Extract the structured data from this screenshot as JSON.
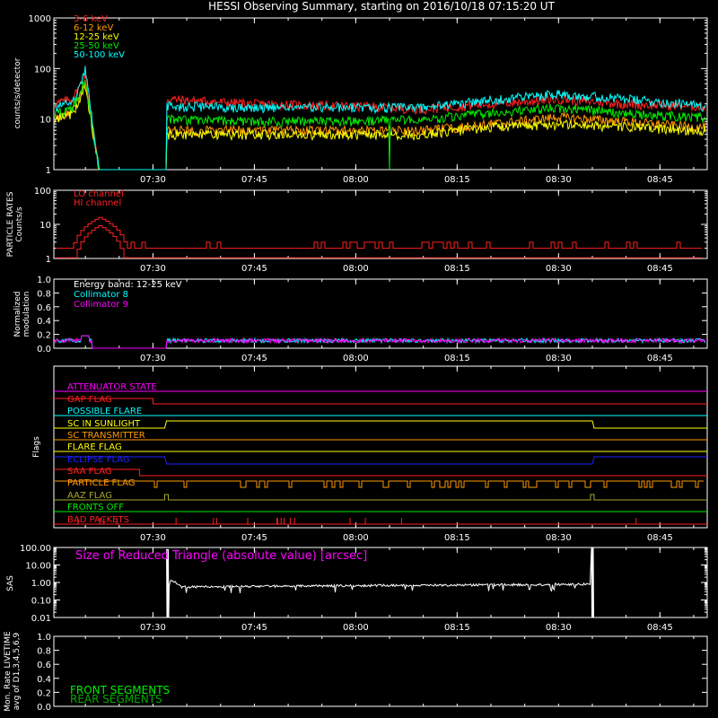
{
  "title": "HESSI Observing Summary, starting on 2016/10/18 07:15:20 UT",
  "time_ticks": [
    "07:30",
    "07:45",
    "08:00",
    "08:15",
    "08:30",
    "08:45"
  ],
  "colors": {
    "red": "#ff2020",
    "orange": "#ff9a00",
    "yellow": "#ffff00",
    "green": "#00ee00",
    "cyan": "#00ffff",
    "magenta": "#ff00ff",
    "blue": "#2020ff",
    "olive": "#a8a830",
    "white": "#ffffff",
    "darkgreen": "#00aa00"
  },
  "chart_data": [
    {
      "id": "count_rates",
      "type": "line",
      "ylabel": "counts/s/detector",
      "yscale": "log",
      "ylim": [
        1,
        1000
      ],
      "ytick_labels": [
        "1",
        "10",
        "100",
        "1000"
      ],
      "x": [
        "07:15:20",
        "07:18",
        "07:19",
        "07:20",
        "07:22",
        "07:22",
        "07:32",
        "07:32",
        "07:45",
        "08:00",
        "08:10",
        "08:20",
        "08:30",
        "08:40",
        "08:50",
        "08:52"
      ],
      "series": [
        {
          "name": "3-6 keV",
          "color": "red",
          "values": [
            20,
            25,
            40,
            80,
            1,
            1,
            1,
            25,
            20,
            18,
            16,
            20,
            25,
            20,
            18,
            18
          ]
        },
        {
          "name": "6-12 keV",
          "color": "orange",
          "values": [
            10,
            14,
            25,
            50,
            1,
            1,
            1,
            6,
            6,
            6,
            6,
            8,
            11,
            9,
            7,
            7
          ]
        },
        {
          "name": "12-25 keV",
          "color": "yellow",
          "values": [
            10,
            13,
            22,
            45,
            1,
            1,
            1,
            5,
            5,
            5,
            5,
            7,
            8,
            7,
            6,
            6
          ]
        },
        {
          "name": "25-50 keV",
          "color": "green",
          "values": [
            13,
            16,
            30,
            60,
            1,
            1,
            1,
            10,
            9,
            9,
            10,
            13,
            17,
            13,
            11,
            11
          ]
        },
        {
          "name": "50-100 keV",
          "color": "cyan",
          "values": [
            17,
            22,
            40,
            95,
            1,
            1,
            1,
            18,
            17,
            17,
            17,
            24,
            32,
            25,
            19,
            18
          ]
        }
      ]
    },
    {
      "id": "particle_rates",
      "type": "line",
      "ylabel": "PARTICLE RATES Counts/s",
      "yscale": "log",
      "ylim": [
        1,
        100
      ],
      "ytick_labels": [
        "1",
        "10",
        "100"
      ],
      "x": [
        "07:16",
        "07:18",
        "07:20",
        "07:22",
        "07:24",
        "07:26",
        "07:28",
        "07:45",
        "08:00",
        "08:15",
        "08:30",
        "08:45",
        "08:52"
      ],
      "series": [
        {
          "name": "LO channel",
          "color": "red",
          "values": [
            2,
            2,
            8,
            14,
            10,
            4,
            2,
            2,
            2,
            2,
            2,
            2,
            2
          ]
        },
        {
          "name": "HI channel",
          "color": "red",
          "values": [
            2,
            2,
            4,
            8,
            5,
            2,
            1,
            1,
            1,
            1,
            1,
            1,
            1
          ]
        }
      ]
    },
    {
      "id": "modulation",
      "type": "line",
      "ylabel": "Normalized modulation",
      "ylim": [
        0.0,
        1.0
      ],
      "ytick_labels": [
        "0.0",
        "0.2",
        "0.4",
        "0.6",
        "0.8",
        "1.0"
      ],
      "annotation": "Energy band: 12-25 keV",
      "x": [
        "07:15:20",
        "07:20",
        "07:21",
        "07:31",
        "07:32",
        "08:52"
      ],
      "series": [
        {
          "name": "Collimator 8",
          "color": "cyan",
          "values": [
            0.1,
            0.1,
            0.0,
            0.0,
            0.1,
            0.1
          ]
        },
        {
          "name": "Collimator 9",
          "color": "magenta",
          "values": [
            0.1,
            0.12,
            0.0,
            0.0,
            0.1,
            0.1
          ]
        }
      ]
    },
    {
      "id": "flags",
      "type": "line",
      "ylabel": "Flags",
      "series": [
        {
          "name": "ATTENUATOR STATE",
          "color": "magenta",
          "transitions": []
        },
        {
          "name": "GAP FLAG",
          "color": "red",
          "transitions": [
            "07:30"
          ]
        },
        {
          "name": "POSSIBLE FLARE",
          "color": "cyan",
          "transitions": []
        },
        {
          "name": "SC IN SUNLIGHT",
          "color": "yellow",
          "transitions": [
            "07:32",
            "08:35"
          ]
        },
        {
          "name": "SC TRANSMITTER",
          "color": "orange",
          "transitions": []
        },
        {
          "name": "FLARE FLAG",
          "color": "yellow",
          "transitions": []
        },
        {
          "name": "ECLIPSE FLAG",
          "color": "blue",
          "transitions": [
            "07:32",
            "08:35"
          ]
        },
        {
          "name": "SAA FLAG",
          "color": "red",
          "transitions": [
            "07:28"
          ]
        },
        {
          "name": "PARTICLE FLAG",
          "color": "orange",
          "transitions": [
            "many"
          ]
        },
        {
          "name": "AAZ FLAG",
          "color": "olive",
          "transitions": [
            "07:32",
            "08:35"
          ]
        },
        {
          "name": "FRONTS OFF",
          "color": "green",
          "transitions": []
        },
        {
          "name": "BAD PACKETS",
          "color": "red",
          "transitions": [
            "sporadic"
          ]
        }
      ]
    },
    {
      "id": "sas",
      "type": "line",
      "ylabel": "SAS",
      "yscale": "log",
      "ylim": [
        0.01,
        100
      ],
      "ytick_labels": [
        "0.01",
        "0.10",
        "1.00",
        "10.00",
        "100.00"
      ],
      "annotation": "Size of Reduced Triangle (absolute value) [arcsec]",
      "x": [
        "07:32",
        "07:33",
        "07:40",
        "08:00",
        "08:20",
        "08:34",
        "08:35"
      ],
      "series": [
        {
          "name": "triangle",
          "color": "white",
          "values": [
            100,
            0.8,
            0.6,
            0.7,
            0.8,
            0.9,
            100
          ]
        }
      ]
    },
    {
      "id": "livetime",
      "type": "line",
      "ylabel": "Mon. Rate LIVETIME avg of D1,3,4,5,6,9",
      "ylim": [
        0.0,
        1.0
      ],
      "ytick_labels": [
        "0.0",
        "0.2",
        "0.4",
        "0.6",
        "0.8",
        "1.0"
      ],
      "series": [
        {
          "name": "FRONT SEGMENTS",
          "color": "green",
          "values": []
        },
        {
          "name": "REAR SEGMENTS",
          "color": "darkgreen",
          "values": []
        }
      ]
    }
  ]
}
